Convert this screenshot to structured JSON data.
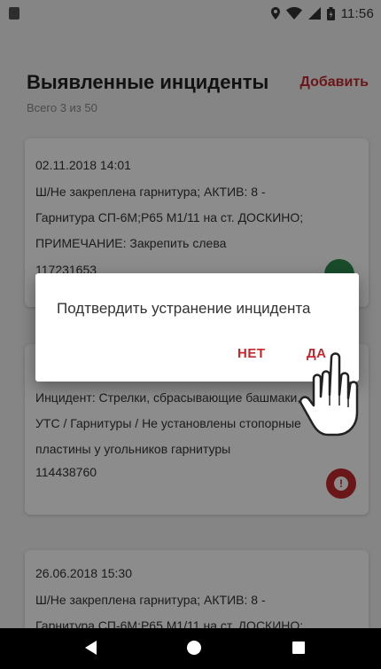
{
  "status_bar": {
    "time": "11:56"
  },
  "header": {
    "title": "Выявленные инциденты",
    "add_label": "Добавить",
    "count_text": "Всего 3 из 50"
  },
  "cards": [
    {
      "datetime": "02.11.2018 14:01",
      "lines": [
        "Ш/Не закреплена гарнитура; АКТИВ: 8 -",
        "Гарнитура СП-6М;Р65 М1/11 на ст. ДОСКИНО;",
        "ПРИМЕЧАНИЕ: Закрепить слева"
      ],
      "number": "117231653",
      "status_color": "#2e8b4f"
    },
    {
      "lines": [
        "Инцидент: Стрелки, сбрасывающие башмаки,",
        "УТС / Гарнитуры / Не установлены стопорные",
        "пластины у угольников гарнитуры"
      ],
      "number": "114438760",
      "status_color": "#c4282d",
      "status_icon": "!"
    },
    {
      "datetime": "26.06.2018 15:30",
      "lines": [
        "Ш/Не закреплена гарнитура; АКТИВ: 8 -",
        "Гарнитура СП-6М;Р65 М1/11 на ст. ДОСКИНО;"
      ]
    }
  ],
  "dialog": {
    "message": "Подтвердить устранение инцидента",
    "no_label": "НЕТ",
    "yes_label": "ДА"
  },
  "icons": {
    "sd_card": "sd-card-icon",
    "location": "location-icon",
    "wifi": "wifi-icon",
    "signal": "signal-icon",
    "battery": "battery-icon",
    "hand": "hand-pointer-icon",
    "back": "back-icon",
    "home": "home-icon",
    "recents": "recents-icon"
  }
}
